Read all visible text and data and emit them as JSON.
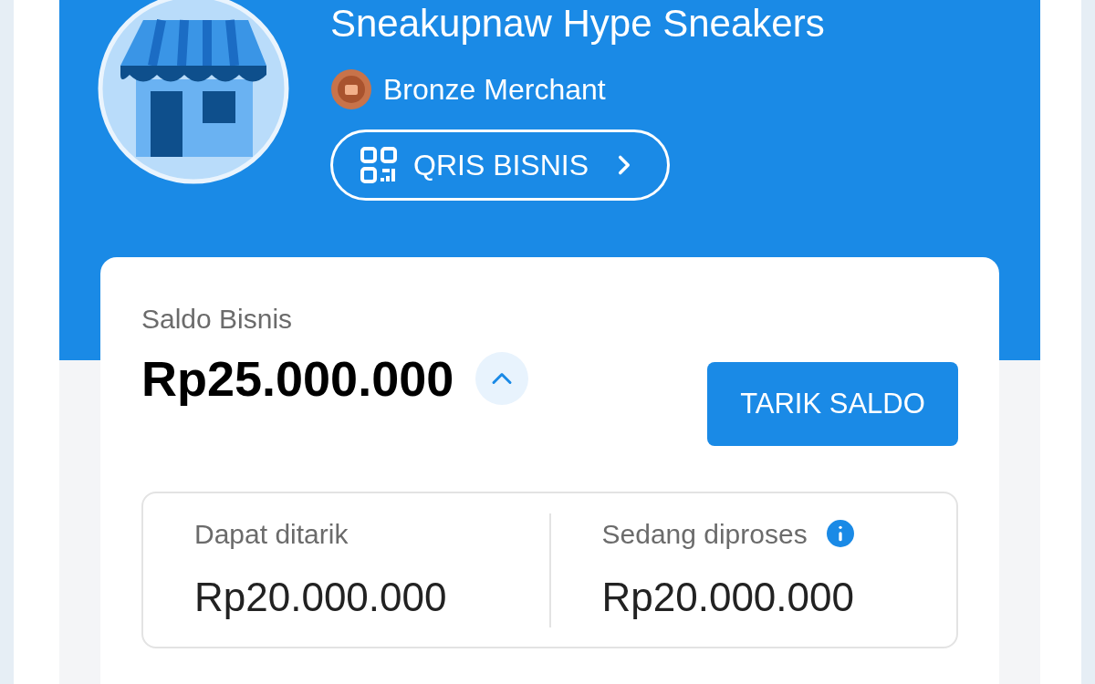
{
  "store": {
    "name": "Sneakupnaw Hype Sneakers",
    "tier": "Bronze Merchant",
    "qris_button": "QRIS BISNIS"
  },
  "balance": {
    "label": "Saldo Bisnis",
    "amount": "Rp25.000.000",
    "expanded": true,
    "withdraw_button": "TARIK SALDO",
    "breakdown": [
      {
        "label": "Dapat ditarik",
        "amount": "Rp20.000.000",
        "info": false
      },
      {
        "label": "Sedang diproses",
        "amount": "Rp20.000.000",
        "info": true
      }
    ]
  }
}
